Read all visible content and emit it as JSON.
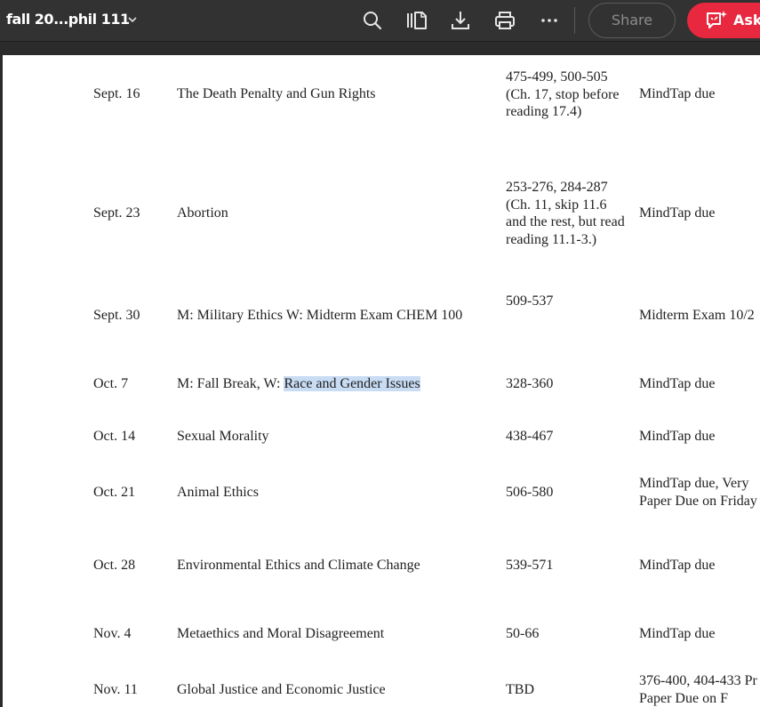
{
  "toolbar": {
    "doc_title": "fall 20...phil 111",
    "share_label": "Share",
    "ask_label": "Ask",
    "icons": [
      "chevron-down-icon",
      "search-icon",
      "page-thumbnails-icon",
      "download-icon",
      "print-icon",
      "more-icon",
      "ai-assistant-icon"
    ]
  },
  "schedule": {
    "rows": [
      {
        "date": "Sept. 16",
        "topic": "The Death Penalty and Gun Rights",
        "reading": [
          "475-499, 500-505",
          "(Ch. 17, stop before",
          "reading 17.4)"
        ],
        "due": [
          "MindTap due"
        ]
      },
      {
        "date": "Sept. 23",
        "topic": "Abortion",
        "reading": [
          "253-276, 284-287",
          "(Ch. 11, skip 11.6",
          "and the rest, but read",
          "reading 11.1-3.)"
        ],
        "due": [
          "MindTap due"
        ]
      },
      {
        "date": "Sept. 30",
        "topic": "M: Military Ethics  W: Midterm Exam CHEM 100",
        "reading": [
          "509-537"
        ],
        "due": [
          "Midterm Exam 10/2"
        ]
      },
      {
        "date": "Oct. 7",
        "topic_prefix": "M:  Fall Break, W: ",
        "topic_highlight": "Race and Gender Issues",
        "reading": [
          "328-360"
        ],
        "due": [
          "MindTap due"
        ]
      },
      {
        "date": "Oct. 14",
        "topic": "Sexual Morality",
        "reading": [
          "438-467"
        ],
        "due": [
          "MindTap due"
        ]
      },
      {
        "date": "Oct. 21",
        "topic": "Animal Ethics",
        "reading": [
          "506-580"
        ],
        "due": [
          "MindTap due, Very",
          "Paper Due on Friday"
        ]
      },
      {
        "date": "Oct. 28",
        "topic": "Environmental Ethics and Climate Change",
        "reading": [
          "539-571"
        ],
        "due": [
          "MindTap due"
        ]
      },
      {
        "date": "Nov. 4",
        "topic": "Metaethics and Moral Disagreement",
        "reading": [
          "50-66"
        ],
        "due": [
          "MindTap due"
        ]
      },
      {
        "date": "Nov. 11",
        "topic": "Global Justice and Economic Justice",
        "reading": [
          "TBD"
        ],
        "due": [
          "376-400, 404-433 Pr",
          "Paper Due on F"
        ]
      }
    ]
  }
}
